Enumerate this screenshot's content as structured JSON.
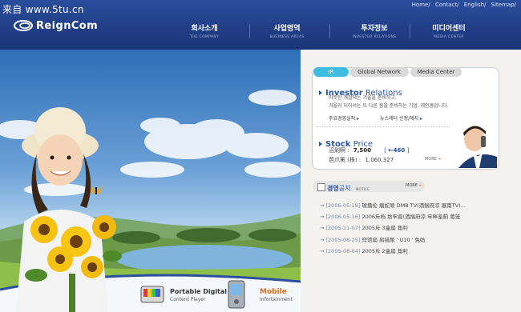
{
  "watermark": "来自 www.5tu.cn",
  "top_links": [
    "Home/",
    "Contact/",
    "English/",
    "Sitemap/"
  ],
  "logo_text": "ReignCom",
  "nav": [
    {
      "ko": "회사소개",
      "en": "THE COMPANY"
    },
    {
      "ko": "사업영역",
      "en": "BUSINESS AREAS"
    },
    {
      "ko": "투자정보",
      "en": "INVESTOR RELATIONS"
    },
    {
      "ko": "미디어센터",
      "en": "MEDIA CENTER"
    }
  ],
  "tabs": [
    "IR",
    "Global Network",
    "Media Center"
  ],
  "ir": {
    "title_a": "Investor",
    "title_b": " Relations",
    "desc1": "따뜻한 계절에는 겨울을 준비하고,",
    "desc2": "겨울이 되어서는 또 다른 봄을 준비하는 기업, 레인콤입니다.",
    "link1": "주요경영실적",
    "link2": "뉴스레터 신청/해지",
    "stock_title_a": "Stock",
    "stock_title_b": " Price",
    "stock_label1": "沼剁啊 :",
    "stock_value": "7,500",
    "stock_change": "-460",
    "stock_label2": "芭爪篤 (株) :",
    "stock_volume": "1,060,327",
    "more": "MORE"
  },
  "notice": {
    "title_a": "경영",
    "title_b": "공지",
    "en": "NOTICE",
    "more": "MORE",
    "items": [
      {
        "date": "[2006-05-18]",
        "text": "琥撸伦 瘤蛇顽 DMB TV(酒揣府凉 器南TV)..."
      },
      {
        "date": "[2006-05-16]",
        "text": "2006斥档 坊牢竟(酒揣府凉 牢畔鉴蓟 葛笼"
      },
      {
        "date": "[2005-11-07]",
        "text": "2005斥 3盒扁 角利"
      },
      {
        "date": "[2005-08-25]",
        "text": "窍馆扁 肩措尿 ' U10 ' 免妨"
      },
      {
        "date": "[2005-08-04]",
        "text": "2005斥 2盒扁 角利"
      }
    ]
  },
  "products": {
    "p1a": "Portable Digital",
    "p1b": "Content Player",
    "p2a": "Mobile",
    "p2b": "Infortainment"
  }
}
